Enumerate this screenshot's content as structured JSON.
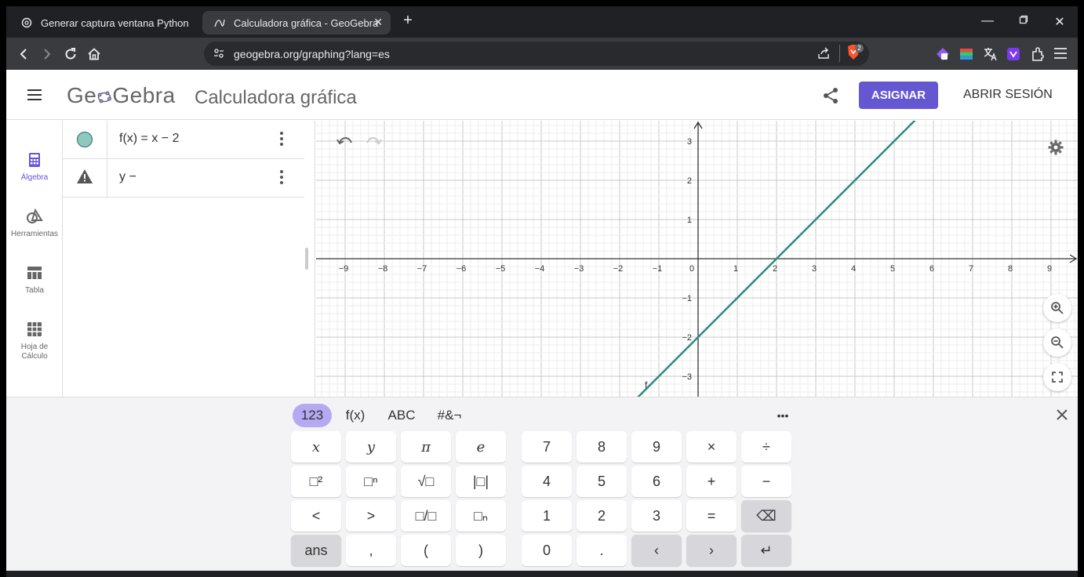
{
  "browser": {
    "tabs": [
      {
        "title": "Generar captura ventana Python",
        "active": false
      },
      {
        "title": "Calculadora gráfica - GeoGebra",
        "active": true
      }
    ],
    "url": "geogebra.org/graphing?lang=es",
    "brave_badge": "2",
    "colors": {
      "chrome_dark": "#202124",
      "chrome_mid": "#3a3b3f"
    }
  },
  "header": {
    "logo_left": "Ge",
    "logo_right": "Gebra",
    "title": "Calculadora gráfica",
    "assign_label": "ASIGNAR",
    "login_label": "ABRIR SESIÓN",
    "accent": "#6557d2"
  },
  "nav": {
    "items": [
      {
        "label": "Álgebra",
        "icon": "calculator-icon",
        "active": true
      },
      {
        "label": "Herramientas",
        "icon": "shapes-icon"
      },
      {
        "label": "Tabla",
        "icon": "table-icon"
      },
      {
        "label": "Hoja de Cálculo",
        "icon": "spreadsheet-icon"
      }
    ]
  },
  "algebra": {
    "rows": [
      {
        "expr": "f(x) = x − 2",
        "marker": "color-dot",
        "color": "#8fc9bd"
      },
      {
        "expr": "y  −",
        "marker": "warning-icon"
      }
    ]
  },
  "graph": {
    "x_ticks": [
      "−9",
      "−8",
      "−7",
      "−6",
      "−5",
      "−4",
      "−3",
      "−2",
      "−1",
      "0",
      "1",
      "2",
      "3",
      "4",
      "5",
      "6",
      "7",
      "8",
      "9"
    ],
    "y_ticks": [
      "3",
      "2",
      "1",
      "−1",
      "−2",
      "−3"
    ],
    "function": {
      "label": "f",
      "slope": 1,
      "intercept": -2,
      "color": "#2a8c7d"
    },
    "x_range": [
      -9.7,
      9.7
    ],
    "y_range": [
      -3.5,
      3.5
    ]
  },
  "keyboard": {
    "tabs": [
      "123",
      "f(x)",
      "ABC",
      "#&¬"
    ],
    "more": "•••",
    "rows": [
      [
        "x",
        "y",
        "π",
        "e",
        "7",
        "8",
        "9",
        "×",
        "÷"
      ],
      [
        "□²",
        "□ⁿ",
        "√□",
        "|□|",
        "4",
        "5",
        "6",
        "+",
        "−"
      ],
      [
        "<",
        ">",
        "□/□",
        "□ₙ",
        "1",
        "2",
        "3",
        "=",
        "⌫"
      ],
      [
        "ans",
        ",",
        "(",
        ")",
        "0",
        ".",
        "‹",
        "›",
        "↵"
      ]
    ]
  }
}
